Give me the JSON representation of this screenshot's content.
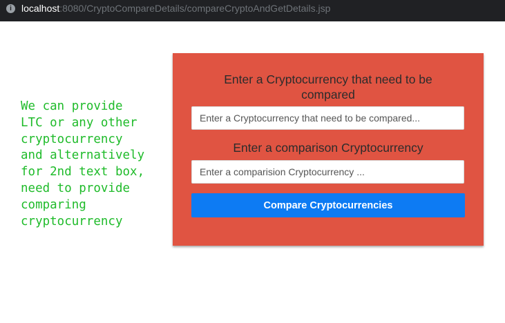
{
  "browser": {
    "url_host": "localhost",
    "url_path": ":8080/CryptoCompareDetails/compareCryptoAndGetDetails.jsp"
  },
  "note": {
    "lines": [
      "We can provide",
      "LTC or any other",
      "cryptocurrency",
      "and alternatively",
      "for 2nd text box,",
      "need to provide",
      "comparing",
      "cryptocurrency"
    ]
  },
  "form": {
    "heading1_line1": "Enter a Cryptocurrency that need to be",
    "heading1_line2": "compared",
    "input1_placeholder": "Enter a Cryptocurrency that need to be compared...",
    "input1_value": "",
    "heading2": "Enter a comparison Cryptocurrency",
    "input2_placeholder": "Enter a comparision Cryptocurrency ...",
    "input2_value": "",
    "button_label": "Compare Cryptocurrencies"
  },
  "colors": {
    "panel_background": "#e05442",
    "button_background": "#0d7bf3",
    "note_text": "#1fbb2a"
  }
}
